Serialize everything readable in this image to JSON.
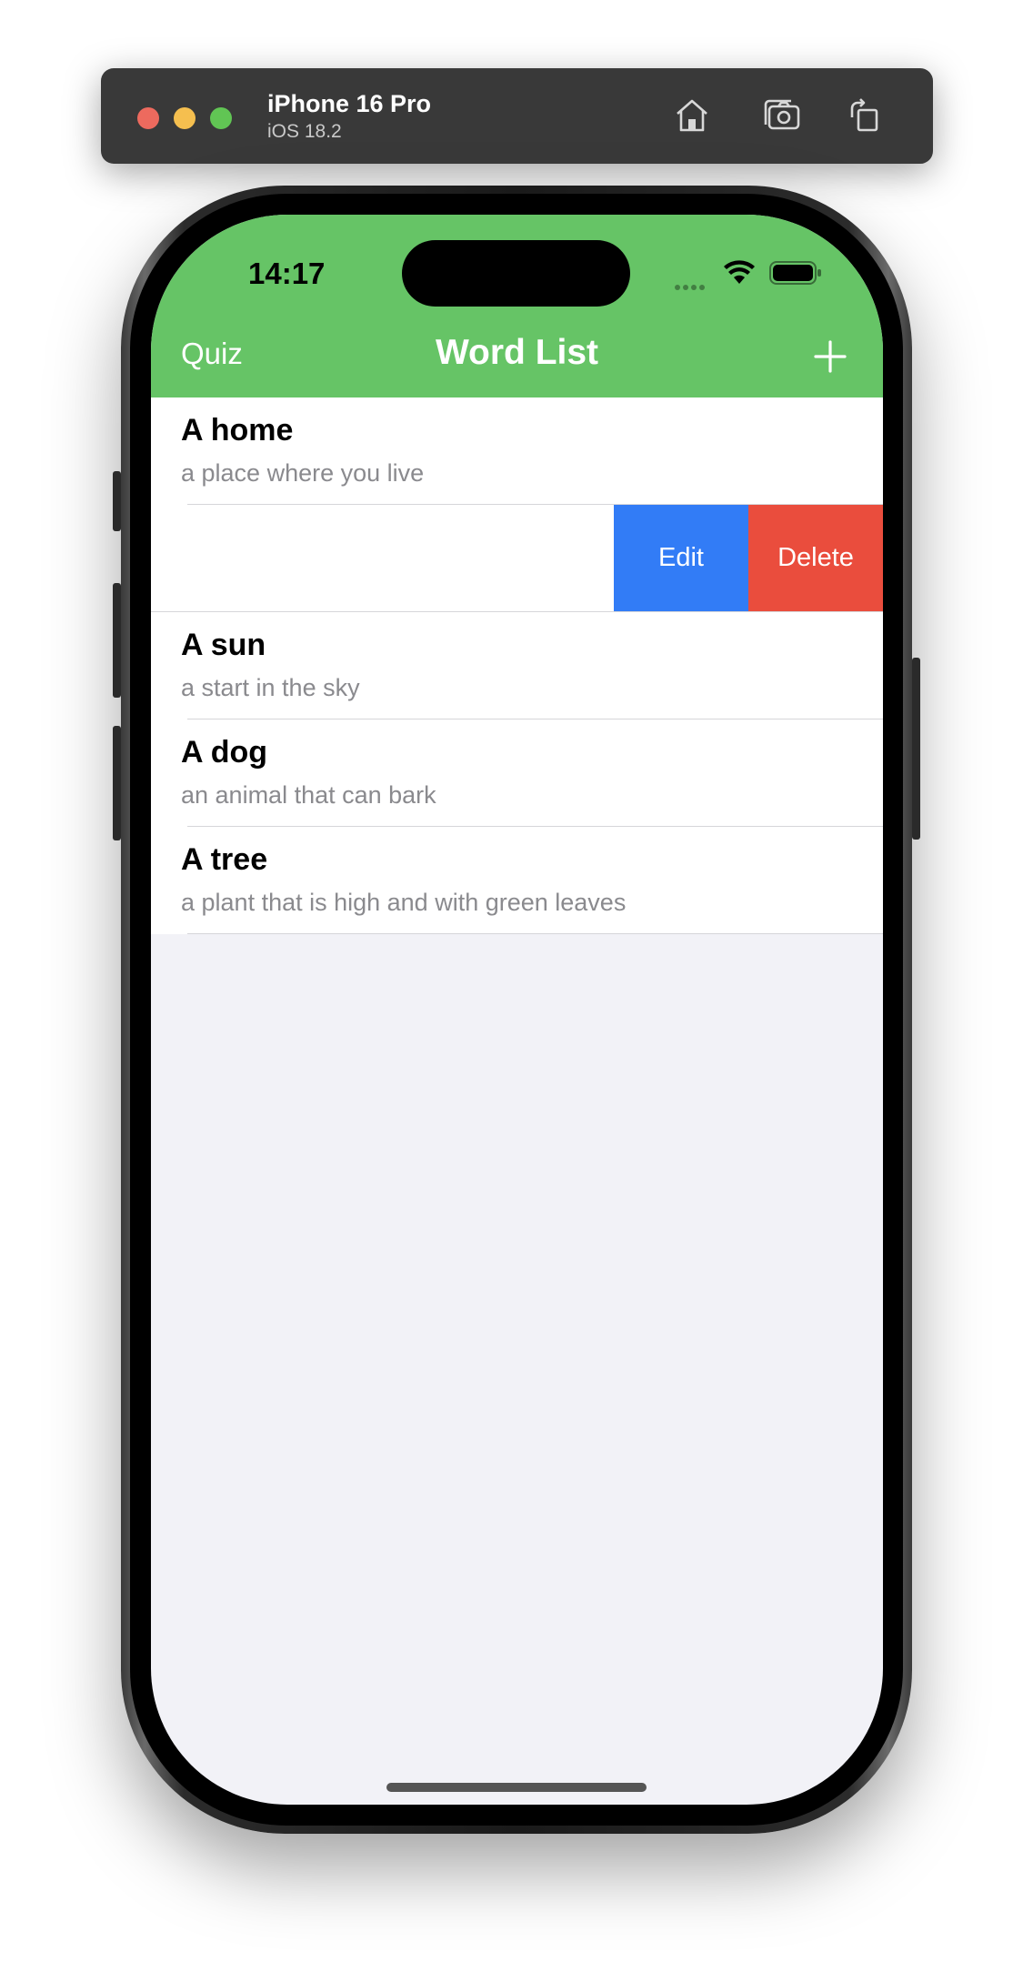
{
  "simulator": {
    "device_name": "iPhone 16 Pro",
    "os_version": "iOS 18.2",
    "icons": [
      "home-icon",
      "screenshot-icon",
      "rotate-icon"
    ],
    "traffic_colors": {
      "close": "#ed6a5e",
      "minimize": "#f5bf4f",
      "maximize": "#61c554"
    }
  },
  "status_bar": {
    "time": "14:17",
    "icons": [
      "cellular-icon",
      "wifi-icon",
      "battery-icon"
    ]
  },
  "nav": {
    "left_button": "Quiz",
    "title": "Word List",
    "right_icon": "plus-icon",
    "background_color": "#66c466"
  },
  "words": [
    {
      "word": "A home",
      "meaning": "a place where you live"
    },
    {
      "word": "A sun",
      "meaning": "a start in the sky"
    },
    {
      "word": "A dog",
      "meaning": "an animal that can bark"
    },
    {
      "word": "A tree",
      "meaning": "a plant that is high and with green leaves"
    }
  ],
  "swipe_actions": {
    "edit_label": "Edit",
    "delete_label": "Delete",
    "edit_color": "#327cf6",
    "delete_color": "#ea4d3d"
  }
}
